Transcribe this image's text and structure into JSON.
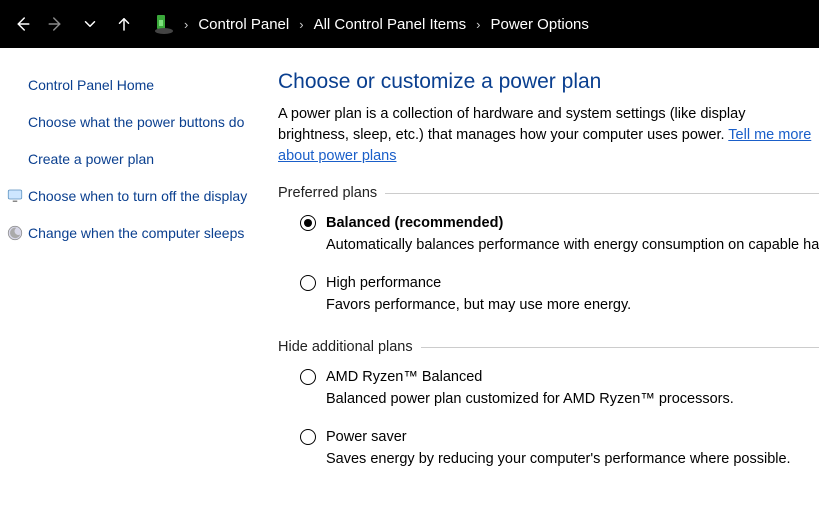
{
  "breadcrumb": {
    "items": [
      "Control Panel",
      "All Control Panel Items",
      "Power Options"
    ]
  },
  "sidebar": {
    "home": "Control Panel Home",
    "links": [
      {
        "label": "Choose what the power buttons do",
        "icon": null
      },
      {
        "label": "Create a power plan",
        "icon": null
      },
      {
        "label": "Choose when to turn off the display",
        "icon": "monitor"
      },
      {
        "label": "Change when the computer sleeps",
        "icon": "moon"
      }
    ]
  },
  "page": {
    "title": "Choose or customize a power plan",
    "intro_pre": "A power plan is a collection of hardware and system settings (like display brightness, sleep, etc.) that manages how your computer uses power. ",
    "intro_link": "Tell me more about power plans"
  },
  "groups": {
    "preferred": {
      "legend": "Preferred plans",
      "plans": [
        {
          "name": "Balanced (recommended)",
          "desc": "Automatically balances performance with energy consumption on capable hardware.",
          "selected": true
        },
        {
          "name": "High performance",
          "desc": "Favors performance, but may use more energy.",
          "selected": false
        }
      ]
    },
    "additional": {
      "legend": "Hide additional plans",
      "plans": [
        {
          "name": "AMD Ryzen™ Balanced",
          "desc": "Balanced power plan customized for AMD Ryzen™ processors.",
          "selected": false
        },
        {
          "name": "Power saver",
          "desc": "Saves energy by reducing your computer's performance where possible.",
          "selected": false
        }
      ]
    }
  }
}
